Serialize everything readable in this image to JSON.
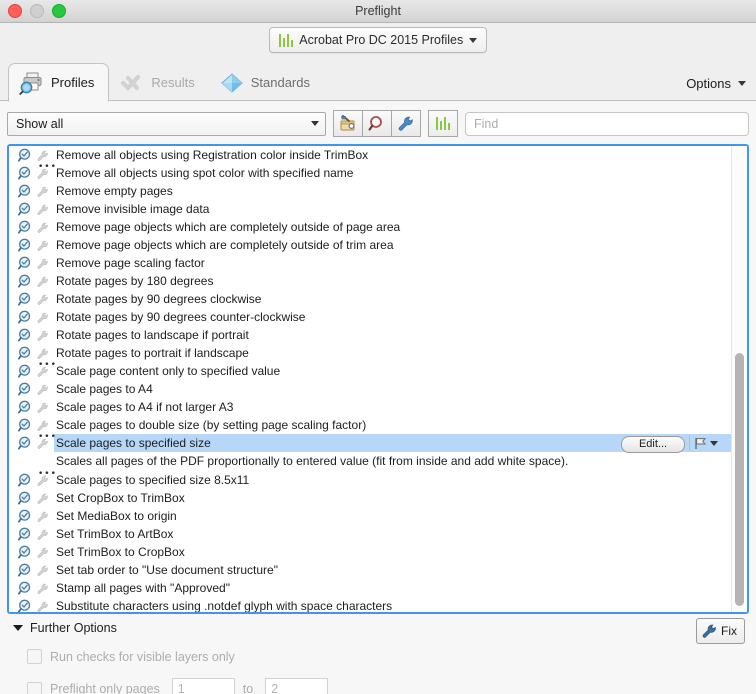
{
  "window": {
    "title": "Preflight",
    "traffic_lights": [
      "close-button",
      "minimize-button",
      "zoom-button"
    ]
  },
  "profile_popup": {
    "label": "Acrobat Pro DC 2015 Profiles",
    "icon": "green-bars-icon"
  },
  "tabs": [
    {
      "label": "Profiles",
      "icon": "printer-magnifier-icon",
      "state": "active"
    },
    {
      "label": "Results",
      "icon": "check-cross-icon",
      "state": "disabled"
    },
    {
      "label": "Standards",
      "icon": "blue-diamond-icon",
      "state": "normal"
    }
  ],
  "options_menu": {
    "label": "Options"
  },
  "filterbar": {
    "show_select": {
      "value": "Show all"
    },
    "buttons": [
      {
        "name": "new-profile-button",
        "icon": "hammer-profile-icon"
      },
      {
        "name": "search-profile-button",
        "icon": "magnifier-icon"
      },
      {
        "name": "fixup-button",
        "icon": "wrench-icon"
      }
    ],
    "standards_button": {
      "icon": "green-bars-icon"
    },
    "find": {
      "placeholder": "Find",
      "value": ""
    }
  },
  "list": {
    "selected_index": 16,
    "selected_description": "Scales all pages of the PDF proportionally to entered value (fit from inside and add white space).",
    "edit_button_label": "Edit...",
    "flag_icon": "flag-icon",
    "items": [
      {
        "label": "Remove all objects using Registration color inside TrimBox",
        "has_dots": false
      },
      {
        "label": "Remove all objects using spot color with specified name",
        "has_dots": true
      },
      {
        "label": "Remove empty pages",
        "has_dots": false
      },
      {
        "label": "Remove invisible image data",
        "has_dots": false
      },
      {
        "label": "Remove page objects which are completely outside of page area",
        "has_dots": false
      },
      {
        "label": "Remove page objects which are completely outside of trim area",
        "has_dots": false
      },
      {
        "label": "Remove page scaling factor",
        "has_dots": false
      },
      {
        "label": "Rotate pages by 180 degrees",
        "has_dots": false
      },
      {
        "label": "Rotate pages by 90 degrees clockwise",
        "has_dots": false
      },
      {
        "label": "Rotate pages by 90 degrees counter-clockwise",
        "has_dots": false
      },
      {
        "label": "Rotate pages to landscape if portrait",
        "has_dots": false
      },
      {
        "label": "Rotate pages to portrait if landscape",
        "has_dots": false
      },
      {
        "label": "Scale page content only to specified value",
        "has_dots": true
      },
      {
        "label": "Scale pages to A4",
        "has_dots": false
      },
      {
        "label": "Scale pages to A4 if not larger A3",
        "has_dots": false
      },
      {
        "label": "Scale pages to double size (by setting page scaling factor)",
        "has_dots": false
      },
      {
        "label": "Scale pages to specified size",
        "has_dots": true
      },
      {
        "label": "Scale pages to specified size 8.5x11",
        "has_dots": true
      },
      {
        "label": "Set CropBox to TrimBox",
        "has_dots": false
      },
      {
        "label": "Set MediaBox to origin",
        "has_dots": false
      },
      {
        "label": "Set TrimBox to ArtBox",
        "has_dots": false
      },
      {
        "label": "Set TrimBox to CropBox",
        "has_dots": false
      },
      {
        "label": "Set tab order to \"Use document structure\"",
        "has_dots": false
      },
      {
        "label": "Stamp all pages with \"Approved\"",
        "has_dots": false
      },
      {
        "label": "Substitute characters using .notdef glyph with space characters",
        "has_dots": false
      }
    ]
  },
  "further_options": {
    "header": "Further Options",
    "fix_button": {
      "label": "Fix",
      "icon": "wrench-icon"
    },
    "visible_layers": {
      "label": "Run checks for visible layers only",
      "checked": false
    },
    "page_range": {
      "label": "Preflight only pages",
      "checked": false,
      "from_value": "1",
      "to_label": "to",
      "to_value": "2"
    }
  },
  "colors": {
    "focus_border": "#3f95ef",
    "selection": "#b6d7f7",
    "accent_green": "#8dc63f",
    "window_bg": "#ececec"
  }
}
